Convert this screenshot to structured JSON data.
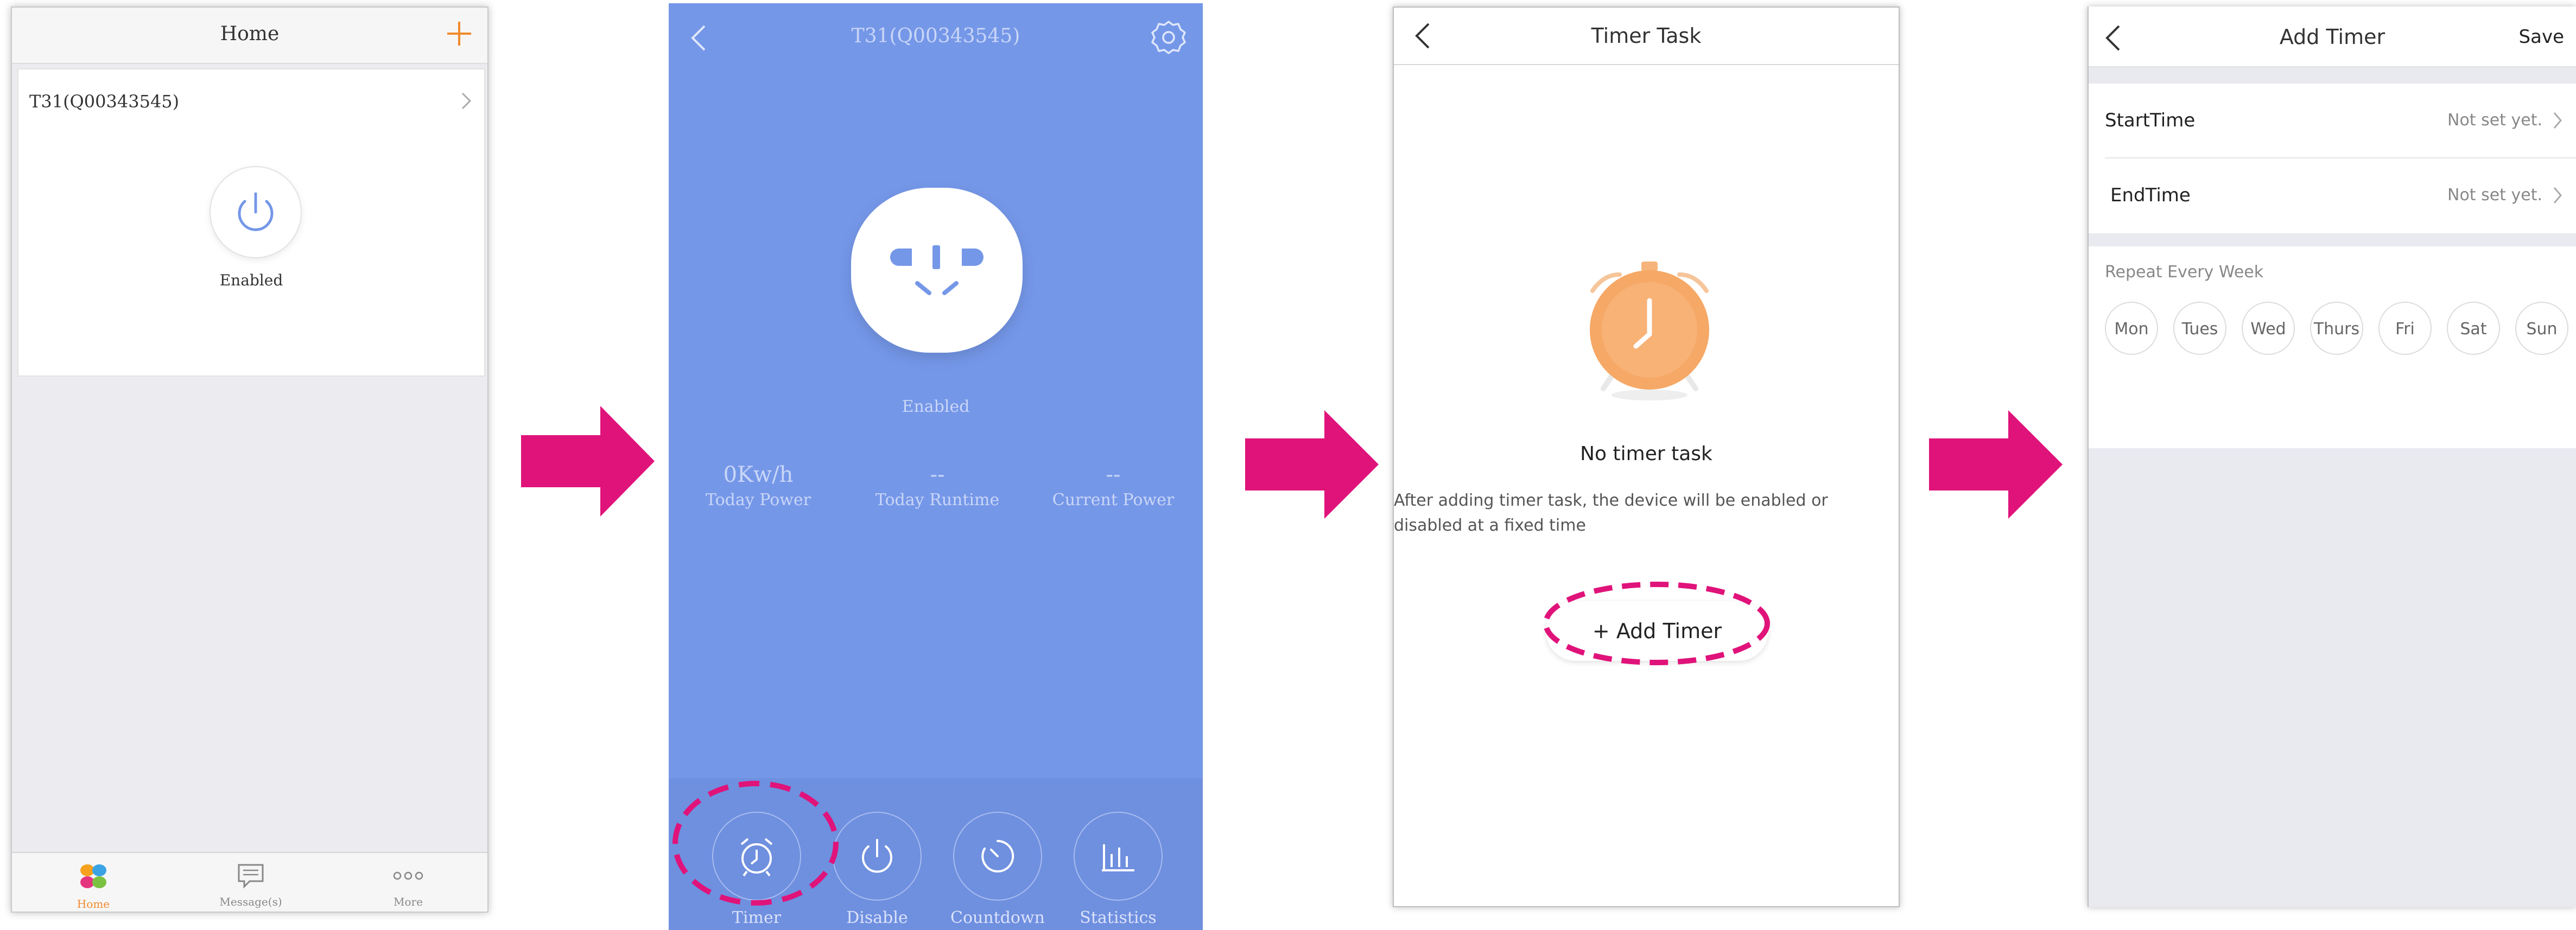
{
  "colors": {
    "accent_orange": "#f08a2c",
    "device_blue": "#7597e8",
    "highlight_magenta": "#e0137a",
    "clock_orange": "#f6a866"
  },
  "screen1": {
    "title": "Home",
    "add_icon": "plus-icon",
    "device_name": "T31(Q00343545)",
    "power_state": "Enabled",
    "tabs": [
      {
        "label": "Home",
        "icon": "app-logo-icon",
        "active": true
      },
      {
        "label": "Message(s)",
        "icon": "message-icon",
        "active": false
      },
      {
        "label": "More",
        "icon": "more-dots-icon",
        "active": false
      }
    ]
  },
  "screen2": {
    "title": "T31(Q00343545)",
    "state": "Enabled",
    "stats": [
      {
        "value": "0Kw/h",
        "label": "Today Power"
      },
      {
        "value": "--",
        "label": "Today Runtime"
      },
      {
        "value": "--",
        "label": "Current Power"
      }
    ],
    "actions": [
      {
        "label": "Timer",
        "icon": "alarm-clock-icon"
      },
      {
        "label": "Disable",
        "icon": "power-icon"
      },
      {
        "label": "Countdown",
        "icon": "countdown-icon"
      },
      {
        "label": "Statistics",
        "icon": "bar-chart-icon"
      }
    ]
  },
  "screen3": {
    "title": "Timer Task",
    "empty_title": "No timer task",
    "empty_desc": "After adding timer task, the device will be enabled or disabled at a fixed time",
    "add_button": "Add Timer"
  },
  "screen4": {
    "title": "Add Timer",
    "save": "Save",
    "start_label": "StartTime",
    "start_value": "Not set yet.",
    "end_label": "EndTime",
    "end_value": "Not set yet.",
    "repeat_label": "Repeat Every Week",
    "days": [
      "Mon",
      "Tues",
      "Wed",
      "Thurs",
      "Fri",
      "Sat",
      "Sun"
    ]
  }
}
